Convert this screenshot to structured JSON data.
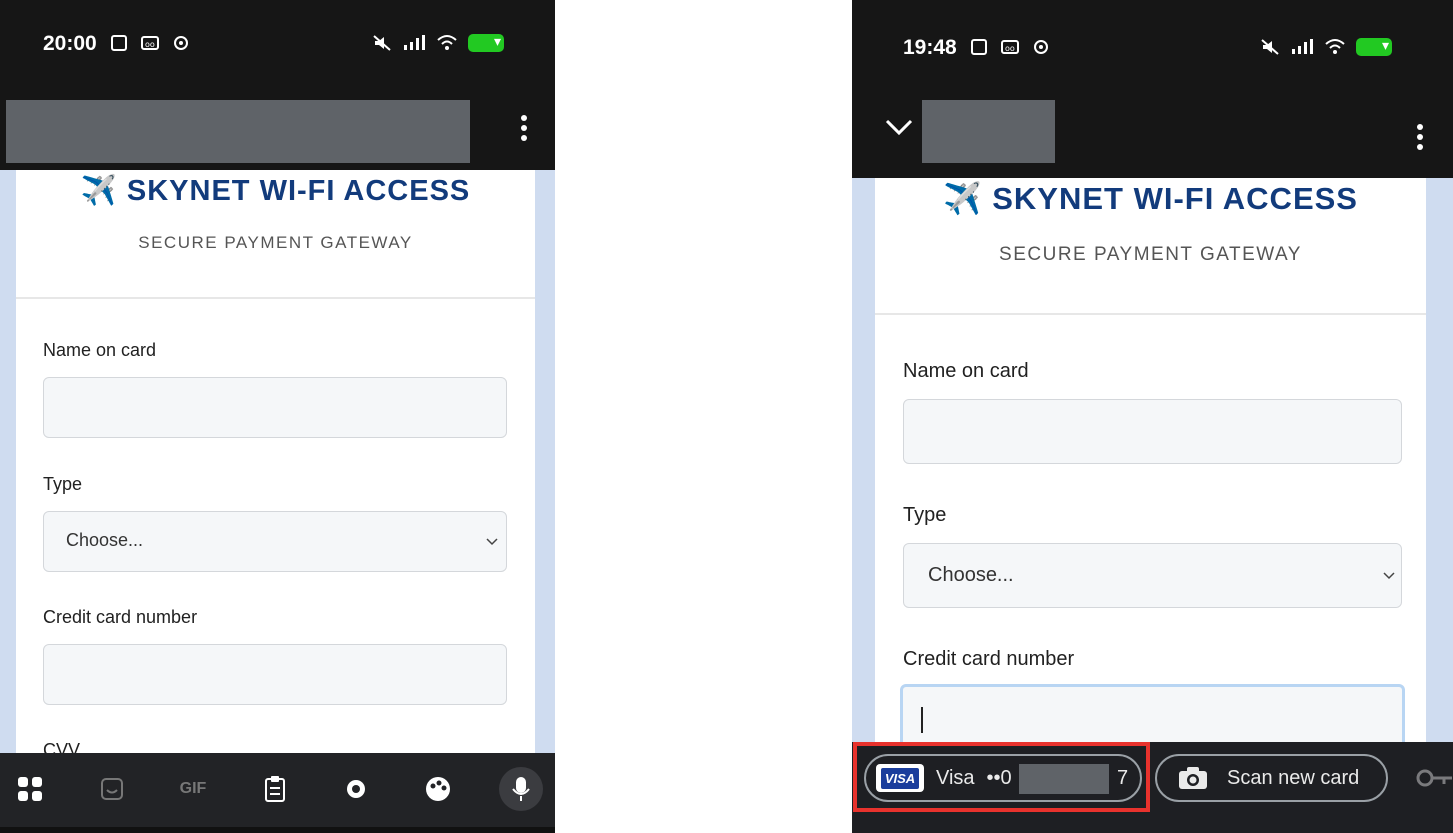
{
  "left": {
    "time": "20:00",
    "brand": "✈️ SKYNET WI-FI ACCESS",
    "subtitle": "SECURE PAYMENT GATEWAY",
    "labels": {
      "name": "Name on card",
      "type": "Type",
      "cc": "Credit card number",
      "cvv": "CVV"
    },
    "type_select": "Choose...",
    "keyboard": {
      "gif": "GIF"
    }
  },
  "right": {
    "time": "19:48",
    "brand": "✈️ SKYNET WI-FI ACCESS",
    "subtitle": "SECURE PAYMENT GATEWAY",
    "labels": {
      "name": "Name on card",
      "type": "Type",
      "cc": "Credit card number"
    },
    "type_select": "Choose...",
    "autofill": {
      "visa_badge": "VISA",
      "visa_label": "Visa",
      "visa_masked": "••0",
      "visa_suffix": "7",
      "scan_label": "Scan new card"
    }
  },
  "colors": {
    "brand": "#123b7c",
    "highlight": "#e8322d",
    "battery": "#22c922"
  }
}
